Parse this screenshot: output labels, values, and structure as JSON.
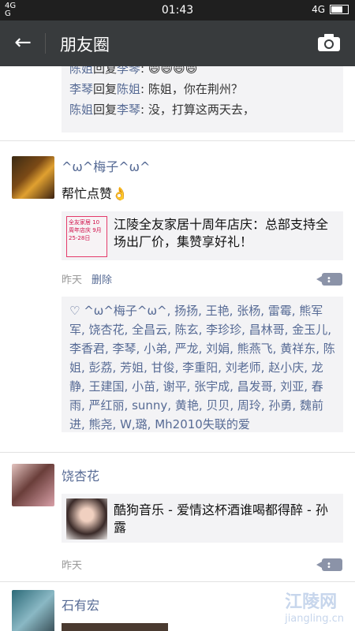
{
  "status": {
    "signal": "4Gₗ \n 4Gₗ",
    "time": "01:43",
    "network": "4G"
  },
  "header": {
    "back": "←",
    "title": "朋友圈"
  },
  "post0": {
    "comments": [
      {
        "from": "陈姐",
        "to": "李琴",
        "text": "😄😄😄😄"
      },
      {
        "from": "李琴",
        "to": "陈姐",
        "text": "陈姐，你在荆州？"
      },
      {
        "from": "陈姐",
        "to": "李琴",
        "text": "没，打算这两天去，"
      }
    ],
    "reply_word": "回复",
    "colon": ": "
  },
  "post1": {
    "name": "^ω^梅子^ω^",
    "text": "帮忙点赞👌",
    "link": {
      "title": "江陵全友家居十周年店庆：总部支持全场出厂价，集赞享好礼！",
      "thumb_text": "全友家居 10周年店庆 9月25-28日"
    },
    "time": "昨天",
    "delete": "删除",
    "likes": "♡ ^ω^梅子^ω^, 扬扬, 王艳, 张杨, 雷霉, 熊军军, 饶杏花, 全昌云, 陈玄, 李珍珍, 昌林哥, 金玉儿, 李香君, 李琴, 小弟, 严龙, 刘娟, 熊燕飞, 黄祥东, 陈姐, 彭荔, 芳姐, 甘俊, 李重阳, 刘老师, 赵小庆, 龙静, 王建国, 小苗, 谢平, 张宇成, 昌发哥, 刘亚, 春雨, 严红丽, sunny, 黄艳, 贝贝, 周玲, 孙勇, 魏前进, 熊尧, W,璐, Mh2010失联的爱"
  },
  "post2": {
    "name": "饶杏花",
    "link": {
      "title": "酷狗音乐 - 爱情这杯酒谁喝都得醉 - 孙露"
    },
    "time": "昨天"
  },
  "post3": {
    "name": "石有宏"
  },
  "watermark": {
    "cn": "江陵网",
    "url": "jiangling.cn"
  },
  "colors": {
    "header": "#383b3d",
    "link": "#576b95"
  }
}
